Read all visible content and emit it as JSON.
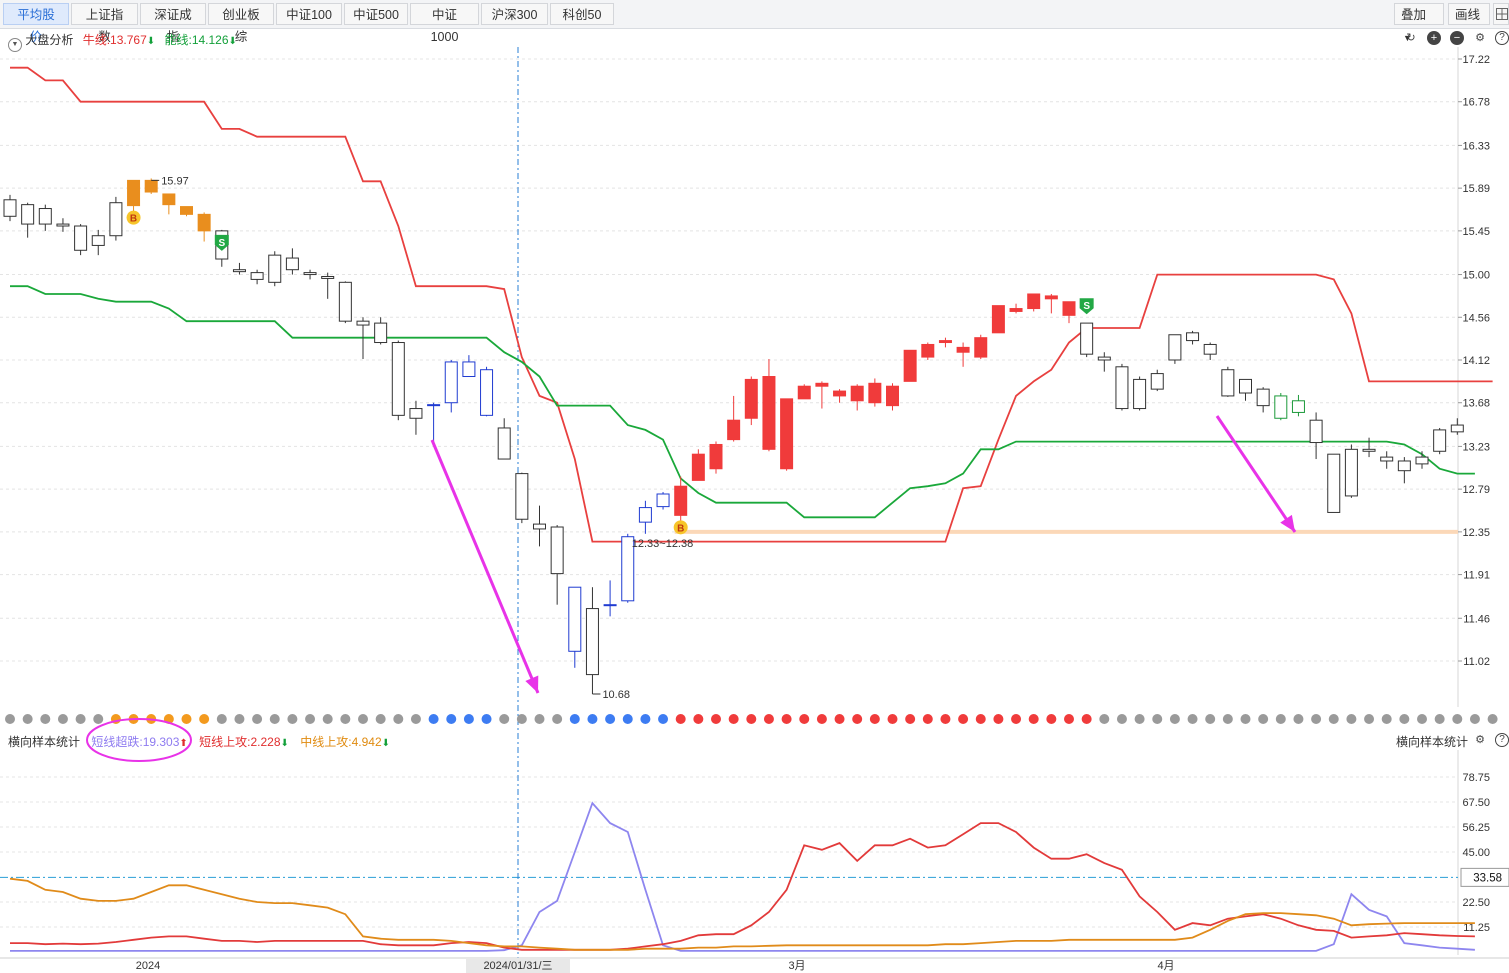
{
  "tabs": [
    "平均股价",
    "上证指数",
    "深证成指",
    "创业板综",
    "中证100",
    "中证500",
    "中证1000",
    "沪深300",
    "科创50"
  ],
  "active_tab": 0,
  "toolbar": {
    "overlay_label": "叠加",
    "draw_label": "画线"
  },
  "main_panel": {
    "title": "大盘分析",
    "niu_label": "牛线:13.767",
    "neng_label": "能线:14.126",
    "y_ticks": [
      "17.22",
      "16.78",
      "16.33",
      "15.89",
      "15.45",
      "15.00",
      "14.56",
      "14.12",
      "13.68",
      "13.23",
      "12.79",
      "12.35",
      "11.91",
      "11.46",
      "11.02"
    ],
    "annotations": {
      "high": "15.97",
      "low": "10.68",
      "range": "12.33~12.38"
    },
    "markers": {
      "buy": "B",
      "sell": "S"
    }
  },
  "sub_panel": {
    "title": "横向样本统计",
    "right_title": "横向样本统计",
    "short_down_label": "短线超跌:19.303",
    "short_up_label": "短线上攻:2.228",
    "mid_up_label": "中线上攻:4.942",
    "y_ticks": [
      "78.75",
      "67.50",
      "56.25",
      "45.00",
      "22.50",
      "11.25"
    ],
    "ref_value": "33.58"
  },
  "x_axis": {
    "labels": [
      "2024",
      "2024/01/31/三",
      "3月",
      "4月"
    ]
  },
  "colors": {
    "up": "#f03b3b",
    "down_outline": "#333333",
    "niu": "#e8403f",
    "neng": "#1aa83a",
    "orange_candle": "#e98e1e",
    "blue_candle": "#1f3bd1",
    "green_candle": "#1c9a3a",
    "arrow": "#e833e8",
    "short_down": "#8e86ef",
    "short_up": "#e23a3a",
    "mid_up": "#e08b1a"
  },
  "chart_data": [
    {
      "type": "candlestick",
      "title": "大盘分析",
      "ylim": [
        10.6,
        17.3
      ],
      "y_ticks": [
        17.22,
        16.78,
        16.33,
        15.89,
        15.45,
        15.0,
        14.56,
        14.12,
        13.68,
        13.23,
        12.79,
        12.35,
        11.91,
        11.46,
        11.02
      ],
      "candles": [
        [
          15.77,
          15.6,
          15.82,
          15.55,
          "w"
        ],
        [
          15.72,
          15.52,
          15.74,
          15.38,
          "w"
        ],
        [
          15.68,
          15.52,
          15.72,
          15.45,
          "w"
        ],
        [
          15.52,
          15.5,
          15.58,
          15.44,
          "w"
        ],
        [
          15.5,
          15.25,
          15.52,
          15.2,
          "w"
        ],
        [
          15.4,
          15.3,
          15.46,
          15.2,
          "w"
        ],
        [
          15.74,
          15.4,
          15.8,
          15.35,
          "w"
        ],
        [
          15.71,
          15.97,
          15.97,
          15.62,
          "o"
        ],
        [
          15.97,
          15.85,
          15.99,
          15.83,
          "o"
        ],
        [
          15.83,
          15.72,
          15.83,
          15.62,
          "o"
        ],
        [
          15.7,
          15.62,
          15.7,
          15.6,
          "o"
        ],
        [
          15.62,
          15.45,
          15.64,
          15.34,
          "o"
        ],
        [
          15.45,
          15.16,
          15.46,
          15.08,
          "w"
        ],
        [
          15.05,
          15.03,
          15.12,
          15.0,
          "w"
        ],
        [
          15.02,
          14.95,
          15.05,
          14.9,
          "w"
        ],
        [
          15.2,
          14.92,
          15.24,
          14.88,
          "w"
        ],
        [
          15.17,
          15.05,
          15.27,
          15.0,
          "w"
        ],
        [
          15.02,
          15.0,
          15.05,
          14.95,
          "w"
        ],
        [
          14.98,
          14.96,
          15.02,
          14.75,
          "w"
        ],
        [
          14.92,
          14.52,
          14.93,
          14.5,
          "w"
        ],
        [
          14.52,
          14.48,
          14.56,
          14.13,
          "w"
        ],
        [
          14.5,
          14.3,
          14.56,
          14.28,
          "w"
        ],
        [
          14.3,
          13.55,
          14.32,
          13.5,
          "w"
        ],
        [
          13.62,
          13.52,
          13.7,
          13.35,
          "w"
        ],
        [
          13.65,
          13.66,
          13.68,
          13.25,
          "b"
        ],
        [
          13.68,
          14.1,
          14.12,
          13.58,
          "b"
        ],
        [
          14.1,
          13.95,
          14.17,
          13.95,
          "b"
        ],
        [
          14.02,
          13.55,
          14.05,
          13.54,
          "b"
        ],
        [
          13.42,
          13.1,
          13.52,
          13.1,
          "w"
        ],
        [
          12.95,
          12.48,
          12.96,
          12.44,
          "w"
        ],
        [
          12.43,
          12.38,
          12.62,
          12.2,
          "w"
        ],
        [
          12.4,
          11.92,
          12.42,
          11.6,
          "w"
        ],
        [
          11.78,
          11.12,
          11.78,
          10.95,
          "b"
        ],
        [
          11.56,
          10.88,
          11.78,
          10.68,
          "w"
        ],
        [
          11.6,
          11.59,
          11.85,
          11.48,
          "b"
        ],
        [
          11.64,
          12.3,
          12.33,
          11.62,
          "b"
        ],
        [
          12.6,
          12.45,
          12.67,
          12.33,
          "b"
        ],
        [
          12.61,
          12.74,
          12.76,
          12.58,
          "b"
        ],
        [
          12.52,
          12.82,
          12.92,
          12.45,
          "r"
        ],
        [
          12.88,
          13.15,
          13.2,
          12.88,
          "r"
        ],
        [
          13.0,
          13.25,
          13.28,
          12.95,
          "r"
        ],
        [
          13.3,
          13.5,
          13.75,
          13.28,
          "r"
        ],
        [
          13.52,
          13.92,
          13.95,
          13.45,
          "r"
        ],
        [
          13.2,
          13.95,
          14.13,
          13.18,
          "r"
        ],
        [
          13.0,
          13.72,
          13.72,
          12.98,
          "r"
        ],
        [
          13.72,
          13.85,
          13.87,
          13.72,
          "r"
        ],
        [
          13.88,
          13.85,
          13.9,
          13.62,
          "r"
        ],
        [
          13.8,
          13.75,
          13.82,
          13.68,
          "r"
        ],
        [
          13.7,
          13.85,
          13.87,
          13.6,
          "r"
        ],
        [
          13.68,
          13.88,
          13.93,
          13.64,
          "r"
        ],
        [
          13.65,
          13.85,
          13.88,
          13.6,
          "r"
        ],
        [
          13.9,
          14.22,
          14.22,
          13.9,
          "r"
        ],
        [
          14.15,
          14.28,
          14.3,
          14.12,
          "r"
        ],
        [
          14.3,
          14.32,
          14.35,
          14.25,
          "r"
        ],
        [
          14.2,
          14.25,
          14.3,
          14.05,
          "r"
        ],
        [
          14.15,
          14.35,
          14.38,
          14.13,
          "r"
        ],
        [
          14.4,
          14.68,
          14.68,
          14.4,
          "r"
        ],
        [
          14.62,
          14.65,
          14.7,
          14.6,
          "r"
        ],
        [
          14.65,
          14.8,
          14.8,
          14.62,
          "r"
        ],
        [
          14.75,
          14.78,
          14.8,
          14.6,
          "r"
        ],
        [
          14.72,
          14.58,
          14.72,
          14.5,
          "r"
        ],
        [
          14.5,
          14.18,
          14.5,
          14.15,
          "w"
        ],
        [
          14.15,
          14.12,
          14.2,
          14.0,
          "w"
        ],
        [
          14.05,
          13.62,
          14.08,
          13.6,
          "w"
        ],
        [
          13.92,
          13.62,
          13.95,
          13.6,
          "w"
        ],
        [
          13.98,
          13.82,
          14.02,
          13.8,
          "w"
        ],
        [
          14.38,
          14.12,
          14.38,
          14.08,
          "w"
        ],
        [
          14.4,
          14.32,
          14.42,
          14.28,
          "w"
        ],
        [
          14.28,
          14.18,
          14.3,
          14.12,
          "w"
        ],
        [
          14.02,
          13.75,
          14.05,
          13.74,
          "w"
        ],
        [
          13.92,
          13.78,
          13.92,
          13.7,
          "w"
        ],
        [
          13.82,
          13.65,
          13.84,
          13.58,
          "w"
        ],
        [
          13.75,
          13.52,
          13.78,
          13.5,
          "g"
        ],
        [
          13.7,
          13.58,
          13.76,
          13.54,
          "g"
        ],
        [
          13.5,
          13.27,
          13.58,
          13.1,
          "w"
        ],
        [
          13.15,
          12.55,
          13.15,
          12.55,
          "w"
        ],
        [
          13.2,
          12.72,
          13.25,
          12.7,
          "w"
        ],
        [
          13.2,
          13.18,
          13.32,
          13.12,
          "w"
        ],
        [
          13.12,
          13.08,
          13.18,
          13.0,
          "w"
        ],
        [
          13.08,
          12.98,
          13.12,
          12.85,
          "w"
        ],
        [
          13.12,
          13.05,
          13.18,
          13.0,
          "w"
        ],
        [
          13.4,
          13.18,
          13.42,
          13.15,
          "w"
        ],
        [
          13.45,
          13.38,
          13.52,
          13.35,
          "w"
        ]
      ],
      "series": [
        {
          "name": "牛线",
          "values": [
            17.13,
            17.13,
            17.0,
            17.0,
            16.78,
            16.78,
            16.78,
            16.78,
            16.78,
            16.78,
            16.78,
            16.78,
            16.5,
            16.5,
            16.42,
            16.42,
            16.42,
            16.42,
            16.42,
            16.42,
            15.96,
            15.96,
            15.5,
            14.88,
            14.88,
            14.88,
            14.88,
            14.88,
            14.85,
            14.15,
            13.75,
            13.68,
            13.1,
            12.25,
            12.25,
            12.25,
            12.25,
            12.25,
            12.25,
            12.25,
            12.25,
            12.25,
            12.25,
            12.25,
            12.25,
            12.25,
            12.25,
            12.25,
            12.25,
            12.25,
            12.25,
            12.25,
            12.25,
            12.25,
            12.8,
            12.82,
            13.3,
            13.75,
            13.9,
            14.02,
            14.3,
            14.45,
            14.45,
            14.45,
            14.45,
            15.0,
            15.0,
            15.0,
            15.0,
            15.0,
            15.0,
            15.0,
            15.0,
            15.0,
            15.0,
            14.95,
            14.6,
            13.9,
            13.9,
            13.9,
            13.9,
            13.9,
            13.9,
            13.9,
            13.9
          ]
        },
        {
          "name": "能线",
          "values": [
            14.88,
            14.88,
            14.8,
            14.8,
            14.8,
            14.75,
            14.72,
            14.72,
            14.72,
            14.65,
            14.52,
            14.52,
            14.52,
            14.52,
            14.52,
            14.52,
            14.35,
            14.35,
            14.35,
            14.35,
            14.35,
            14.35,
            14.35,
            14.35,
            14.35,
            14.35,
            14.35,
            14.35,
            14.2,
            14.1,
            13.95,
            13.65,
            13.65,
            13.65,
            13.65,
            13.45,
            13.4,
            13.3,
            12.9,
            12.75,
            12.65,
            12.65,
            12.65,
            12.65,
            12.65,
            12.5,
            12.5,
            12.5,
            12.5,
            12.5,
            12.65,
            12.8,
            12.82,
            12.85,
            12.95,
            13.2,
            13.2,
            13.28,
            13.28,
            13.28,
            13.28,
            13.28,
            13.28,
            13.28,
            13.28,
            13.28,
            13.28,
            13.28,
            13.28,
            13.28,
            13.28,
            13.28,
            13.28,
            13.28,
            13.28,
            13.28,
            13.28,
            13.28,
            13.28,
            13.25,
            13.15,
            13.0,
            12.95,
            12.95
          ]
        }
      ]
    },
    {
      "type": "line",
      "title": "横向样本统计",
      "ylim": [
        0,
        88
      ],
      "y_ticks": [
        78.75,
        67.5,
        56.25,
        45.0,
        22.5,
        11.25
      ],
      "reference_line": 33.58,
      "series": [
        {
          "name": "短线超跌",
          "values": [
            0.5,
            0.5,
            0.5,
            0.5,
            0.5,
            0.5,
            0.5,
            0.5,
            0.5,
            0.5,
            0.5,
            0.5,
            0.5,
            0.5,
            0.5,
            0.5,
            0.5,
            0.5,
            0.5,
            0.5,
            0.5,
            0.5,
            0.5,
            0.5,
            0.5,
            0.5,
            0.5,
            0.5,
            0.8,
            3.0,
            18.0,
            23.0,
            45.0,
            67.0,
            58.0,
            54.0,
            28.0,
            3.0,
            0.5,
            0.5,
            0.5,
            0.5,
            0.5,
            0.5,
            0.5,
            0.5,
            0.5,
            0.5,
            0.5,
            0.5,
            0.5,
            0.5,
            0.5,
            0.5,
            0.5,
            0.5,
            0.5,
            0.5,
            0.5,
            0.5,
            0.5,
            0.5,
            0.5,
            0.5,
            0.5,
            0.5,
            0.5,
            0.5,
            0.5,
            0.5,
            0.5,
            0.5,
            0.5,
            0.5,
            0.5,
            3.5,
            26.0,
            19.0,
            16.0,
            4.0,
            3.0,
            2.0,
            1.5,
            1.0
          ]
        },
        {
          "name": "短线上攻",
          "values": [
            4.0,
            4.0,
            3.5,
            3.8,
            3.5,
            3.8,
            4.5,
            5.5,
            6.5,
            7.0,
            7.0,
            6.0,
            5.0,
            5.0,
            4.5,
            5.0,
            5.0,
            5.0,
            5.0,
            5.0,
            5.0,
            3.5,
            3.0,
            3.0,
            3.0,
            4.0,
            4.5,
            4.0,
            2.0,
            1.0,
            1.0,
            1.0,
            1.0,
            1.0,
            1.0,
            1.5,
            2.5,
            3.5,
            5.0,
            7.5,
            8.0,
            8.0,
            12.0,
            18.0,
            28.0,
            48.0,
            46.0,
            49.0,
            41.0,
            48.0,
            48.0,
            51.0,
            47.0,
            48.0,
            53.0,
            58.0,
            58.0,
            54.0,
            47.0,
            42.0,
            42.0,
            44.0,
            40.0,
            37.0,
            25.0,
            18.0,
            10.0,
            13.0,
            12.0,
            15.0,
            16.0,
            17.0,
            15.0,
            12.0,
            10.0,
            9.5,
            6.5,
            7.0,
            7.5,
            8.5,
            8.0,
            7.5,
            7.2,
            7.0
          ]
        },
        {
          "name": "中线上攻",
          "values": [
            33.0,
            32.0,
            28.0,
            27.0,
            24.0,
            23.0,
            23.0,
            24.0,
            27.0,
            30.0,
            30.0,
            28.0,
            26.0,
            24.0,
            22.5,
            22.0,
            22.0,
            21.0,
            20.0,
            17.0,
            7.0,
            6.0,
            5.5,
            5.5,
            5.5,
            5.0,
            4.0,
            3.0,
            2.5,
            2.5,
            2.0,
            1.5,
            1.0,
            1.0,
            1.0,
            1.0,
            1.5,
            1.5,
            1.5,
            2.0,
            2.0,
            2.5,
            2.5,
            2.8,
            3.0,
            3.0,
            3.0,
            3.0,
            3.0,
            3.0,
            3.0,
            3.0,
            3.0,
            3.5,
            3.5,
            4.0,
            4.5,
            5.0,
            5.0,
            5.0,
            5.5,
            5.5,
            5.5,
            5.5,
            5.5,
            5.5,
            5.5,
            6.5,
            10.0,
            14.0,
            17.0,
            17.5,
            17.5,
            17.0,
            16.5,
            15.0,
            12.0,
            12.5,
            12.8,
            13.0,
            13.0,
            13.0,
            13.0,
            13.0
          ]
        }
      ]
    }
  ]
}
